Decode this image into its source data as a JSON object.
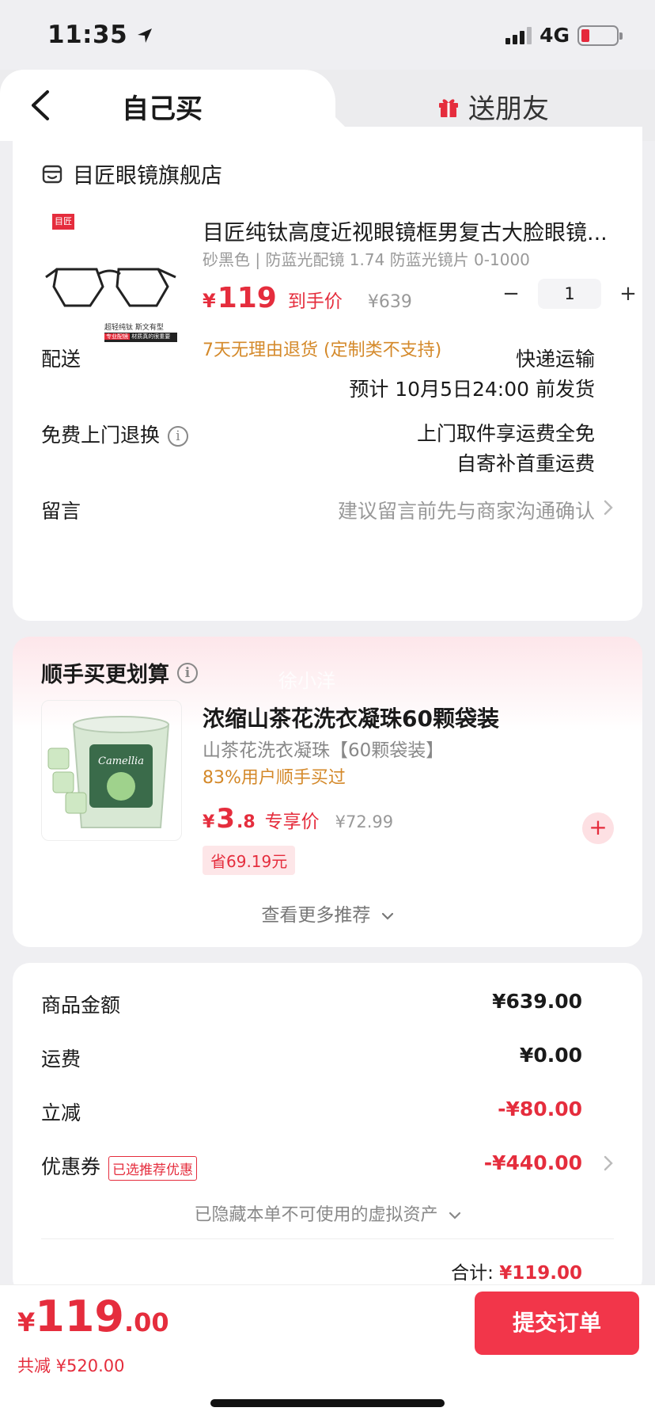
{
  "status_bar": {
    "time": "11:35",
    "network": "4G"
  },
  "tabs": {
    "self_buy": "自己买",
    "gift": "送朋友"
  },
  "shop": {
    "name": "目匠眼镜旗舰店"
  },
  "product": {
    "title": "目匠纯钛高度近视眼镜框男复古大脸眼镜...",
    "spec": "砂黑色 | 防蓝光配镜 1.74 防蓝光镜片 0-1000",
    "price_symbol": "¥",
    "price": "119",
    "price_tag": "到手价",
    "original_price": "¥639",
    "quantity": "1",
    "qty_minus": "−",
    "qty_plus": "+",
    "return_note": "7天无理由退货 (定制类不支持)",
    "img_caption_1": "超轻纯钛 斯文有型",
    "img_caption_2a": "专业配镜",
    "img_caption_2b": "材质真的很重要",
    "logo_text": "目匠"
  },
  "delivery": {
    "label": "配送",
    "method": "快递运输",
    "estimate": "预计 10月5日24:00 前发货"
  },
  "return_service": {
    "label": "免费上门退换",
    "info_icon": "i",
    "line1": "上门取件享运费全免",
    "line2": "自寄补首重运费"
  },
  "message": {
    "label": "留言",
    "placeholder": "建议留言前先与商家沟通确认"
  },
  "recommend": {
    "section_title": "顺手买更划算",
    "watermark": "徐小洋",
    "name": "浓缩山茶花洗衣凝珠60颗袋装",
    "spec": "山茶花洗衣凝珠【60颗袋装】",
    "buy_rate": "83%用户顺手买过",
    "price_symbol": "¥",
    "price_int": "3",
    "price_dec": ".8",
    "price_tag": "专享价",
    "original_price": "¥72.99",
    "save": "省69.19元",
    "add": "+",
    "more": "查看更多推荐",
    "product_logo": "Camellia"
  },
  "summary": {
    "goods_label": "商品金额",
    "goods_value": "¥639.00",
    "shipping_label": "运费",
    "shipping_value": "¥0.00",
    "discount_label": "立减",
    "discount_value": "-¥80.00",
    "coupon_label": "优惠券",
    "coupon_badge": "已选推荐优惠",
    "coupon_value": "-¥440.00",
    "hidden_assets": "已隐藏本单不可使用的虚拟资产",
    "total_label": "合计:",
    "total_value": "¥119.00"
  },
  "bottom": {
    "symbol": "¥",
    "amount_int": "119",
    "amount_dec": ".00",
    "saved": "共减 ¥520.00",
    "submit": "提交订单"
  },
  "colors": {
    "accent": "#e52d3d",
    "orange": "#d4892a",
    "submit": "#f2364a"
  }
}
